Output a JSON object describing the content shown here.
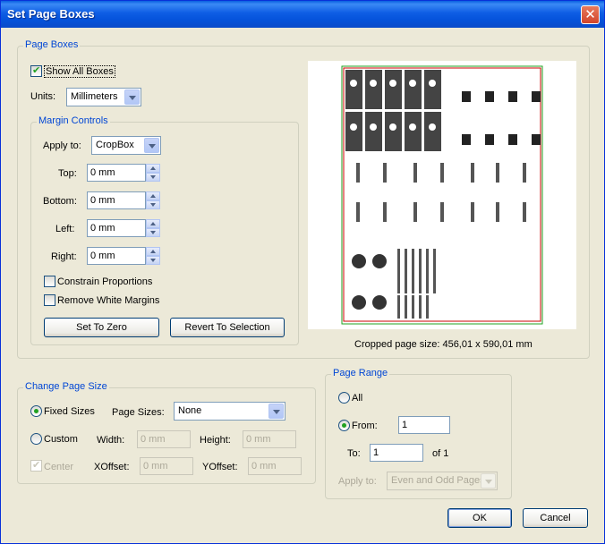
{
  "window": {
    "title": "Set Page Boxes",
    "close_glyph": "✕"
  },
  "page_boxes": {
    "legend": "Page Boxes",
    "show_all_boxes_label": "Show All Boxes",
    "show_all_boxes_checked": true,
    "units_label": "Units:",
    "units_value": "Millimeters",
    "margin_controls": {
      "legend": "Margin Controls",
      "apply_to_label": "Apply to:",
      "apply_to_value": "CropBox",
      "top_label": "Top:",
      "top_value": "0 mm",
      "bottom_label": "Bottom:",
      "bottom_value": "0 mm",
      "left_label": "Left:",
      "left_value": "0 mm",
      "right_label": "Right:",
      "right_value": "0 mm",
      "constrain_label": "Constrain Proportions",
      "remove_white_label": "Remove White Margins",
      "set_to_zero_label": "Set To Zero",
      "revert_label": "Revert To Selection"
    },
    "cropped_size_text": "Cropped page size: 456,01 x 590,01 mm"
  },
  "change_page_size": {
    "legend": "Change Page Size",
    "fixed_sizes_label": "Fixed Sizes",
    "page_sizes_label": "Page Sizes:",
    "page_sizes_value": "None",
    "custom_label": "Custom",
    "width_label": "Width:",
    "width_value": "0 mm",
    "height_label": "Height:",
    "height_value": "0 mm",
    "center_label": "Center",
    "xoffset_label": "XOffset:",
    "xoffset_value": "0 mm",
    "yoffset_label": "YOffset:",
    "yoffset_value": "0 mm"
  },
  "page_range": {
    "legend": "Page Range",
    "all_label": "All",
    "from_label": "From:",
    "from_value": "1",
    "to_label": "To:",
    "to_value": "1",
    "of_text": "of 1",
    "apply_to_label": "Apply to:",
    "apply_to_value": "Even and Odd Pages"
  },
  "buttons": {
    "ok": "OK",
    "cancel": "Cancel"
  },
  "colors": {
    "title_bar": "#0a5fe0",
    "legend_text": "#0046d5",
    "close": "#d2452b",
    "crop_box": "#21a121",
    "trim_box": "#cc0000"
  }
}
